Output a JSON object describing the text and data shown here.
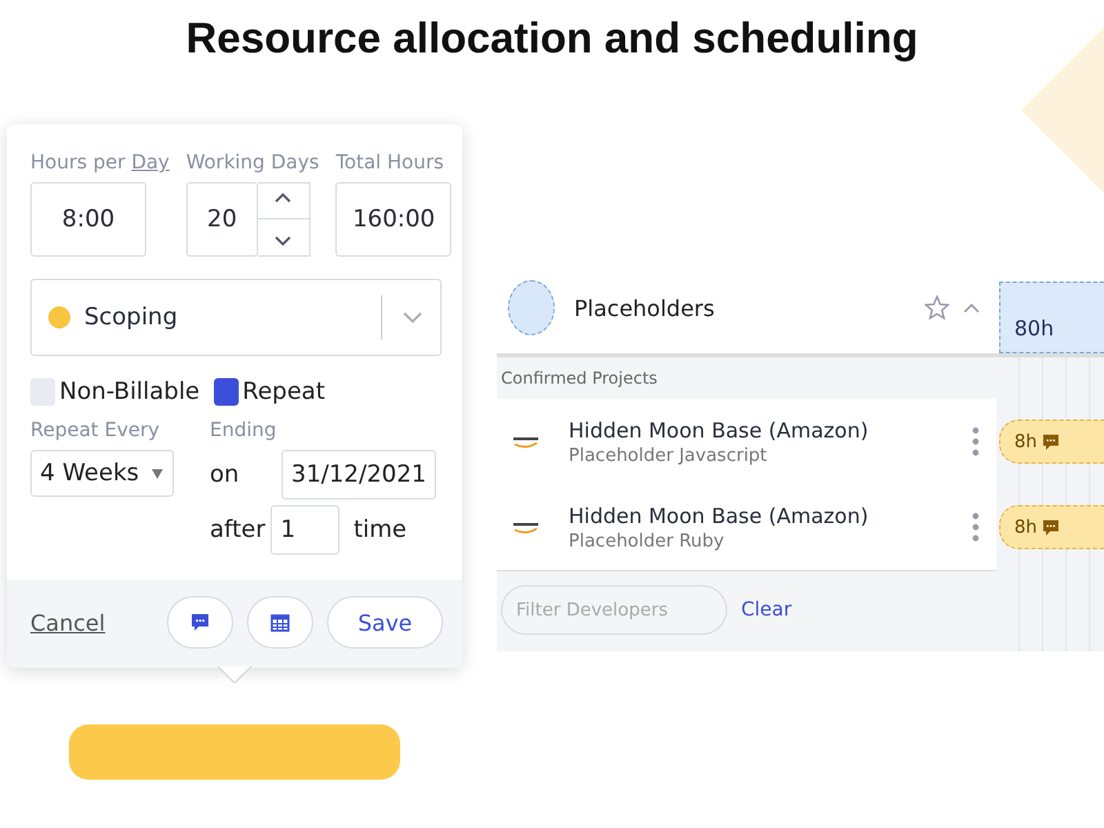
{
  "title": "Resource allocation and scheduling",
  "popup": {
    "hours_per_day": {
      "label": "Hours per",
      "link": "Day",
      "value": "8:00"
    },
    "working_days": {
      "label": "Working Days",
      "value": "20"
    },
    "total_hours": {
      "label": "Total Hours",
      "value": "160:00"
    },
    "status": {
      "label": "Scoping",
      "color": "#f8c540"
    },
    "checkboxes": [
      {
        "label": "Non-Billable",
        "checked": false
      },
      {
        "label": "Repeat",
        "checked": true
      }
    ],
    "repeat_every": {
      "label": "Repeat Every",
      "value": "4 Weeks"
    },
    "ending": {
      "label": "Ending",
      "on_label": "on",
      "on_value": "31/12/2021",
      "after_label": "after",
      "after_value": "1",
      "after_unit": "time"
    },
    "footer": {
      "cancel": "Cancel",
      "save": "Save"
    }
  },
  "placeholders": {
    "title": "Placeholders",
    "starred": false,
    "expanded": true,
    "total": "80h"
  },
  "section": "Confirmed Projects",
  "projects": [
    {
      "name": "Hidden Moon Base (Amazon)",
      "role": "Placeholder Javascript",
      "hours": "8h"
    },
    {
      "name": "Hidden Moon Base (Amazon)",
      "role": "Placeholder Ruby",
      "hours": "8h"
    }
  ],
  "filter": {
    "placeholder": "Filter Developers",
    "clear": "Clear"
  }
}
